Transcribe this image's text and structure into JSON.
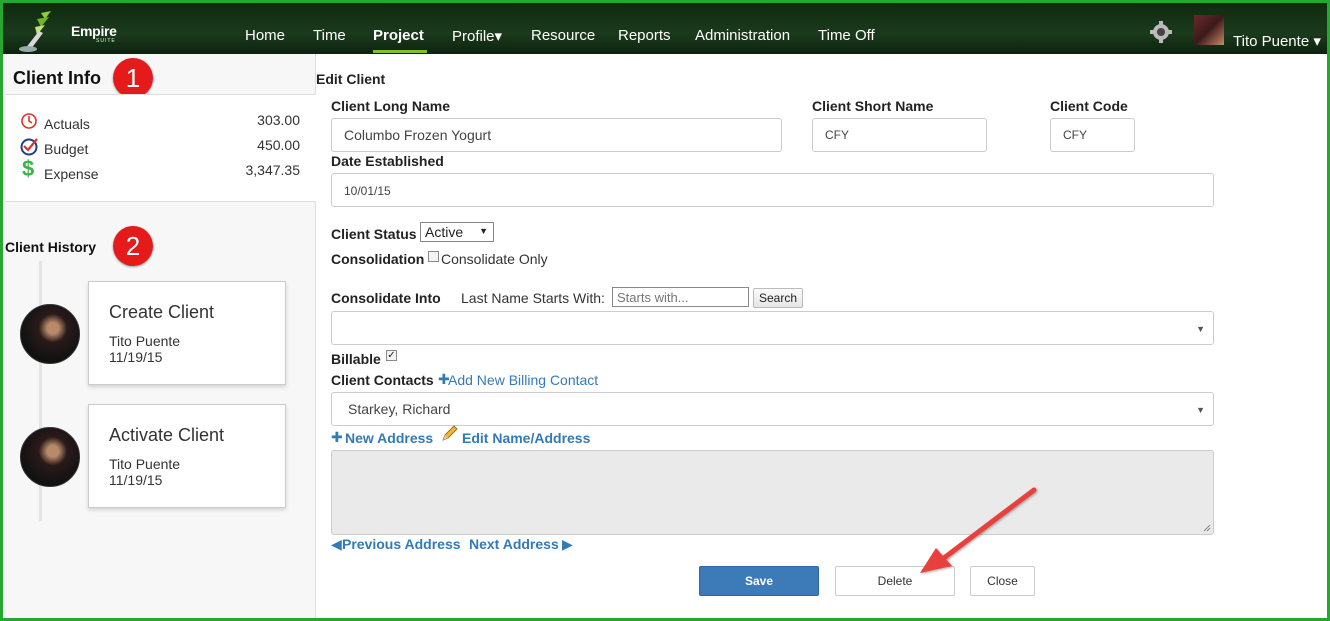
{
  "app": {
    "logo_text": "Empire",
    "logo_sub": "SUITE"
  },
  "nav": {
    "items": [
      "Home",
      "Time",
      "Project",
      "Profile▾",
      "Resource",
      "Reports",
      "Administration",
      "Time Off"
    ],
    "active": "Project",
    "username": "Tito Puente ▾"
  },
  "sidebar": {
    "info_title": "Client Info",
    "badge1": "1",
    "badge2": "2",
    "info_rows": [
      {
        "label": "Actuals",
        "value": "303.00",
        "icon": "clock-icon"
      },
      {
        "label": "Budget",
        "value": "450.00",
        "icon": "check-circle-icon"
      },
      {
        "label": "Expense",
        "value": "3,347.35",
        "icon": "dollar-icon"
      }
    ],
    "history_title": "Client History",
    "events": [
      {
        "title": "Create Client",
        "user": "Tito Puente",
        "date": "11/19/15"
      },
      {
        "title": "Activate Client",
        "user": "Tito Puente",
        "date": "11/19/15"
      }
    ]
  },
  "form": {
    "heading": "Edit Client",
    "long_name_label": "Client Long Name",
    "long_name_value": "Columbo Frozen Yogurt",
    "short_name_label": "Client Short Name",
    "short_name_value": "CFY",
    "code_label": "Client Code",
    "code_value": "CFY",
    "date_label": "Date Established",
    "date_value": "10/01/15",
    "status_label": "Client Status",
    "status_value": "Active",
    "consolidation_label": "Consolidation",
    "consolidate_only_label": "Consolidate Only",
    "consolidate_into_label": "Consolidate Into",
    "last_name_label": "Last Name Starts With:",
    "search_placeholder": "Starts with...",
    "search_button": "Search",
    "consolidate_select_value": "",
    "billable_label": "Billable",
    "billable_check": "✓",
    "contacts_label": "Client Contacts",
    "add_contact_link": "Add New Billing Contact",
    "contact_value": "Starkey, Richard",
    "new_address_link": "New Address",
    "edit_address_link": "Edit Name/Address",
    "prev_address_link": "Previous Address",
    "next_address_link": "Next Address",
    "save_button": "Save",
    "delete_button": "Delete",
    "close_button": "Close"
  },
  "colors": {
    "frame": "#27a632",
    "nav_bg": "#1b3a1c",
    "accent": "#7ec225",
    "badge": "#e51b1b",
    "link": "#337ab7",
    "primary_button": "#3d7ab8",
    "annotation_arrow": "#e8413e"
  }
}
